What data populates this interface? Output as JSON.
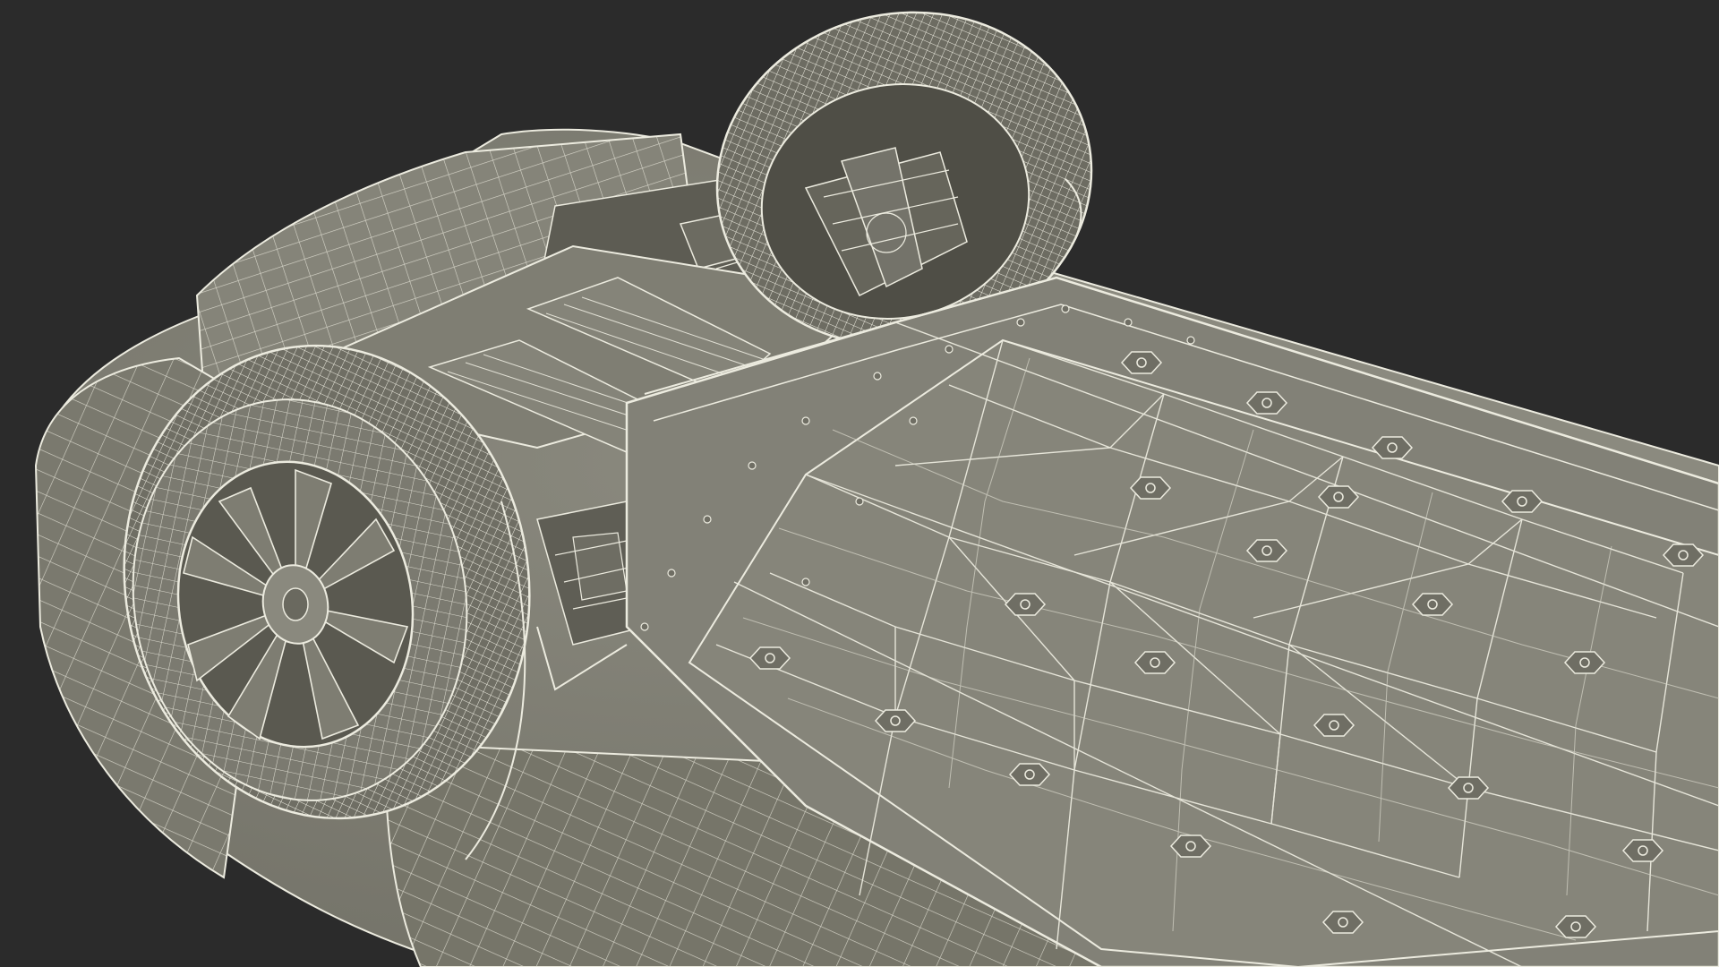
{
  "scene": {
    "background_color": "#2b2b2b",
    "shell_color": "#7e7d72",
    "shell_shadow_color": "#5f5e55",
    "shell_highlight_color": "#8e8d82",
    "wire_color": "#ecebdf",
    "wire_dim_color": "#cfcec1",
    "objects": [
      "vehicle-body-shell",
      "underbody-floor-panel",
      "rear-wheel-left",
      "rear-wheel-right",
      "rear-suspension-assembly",
      "heat-shield-plates",
      "mounting-bolts"
    ]
  }
}
